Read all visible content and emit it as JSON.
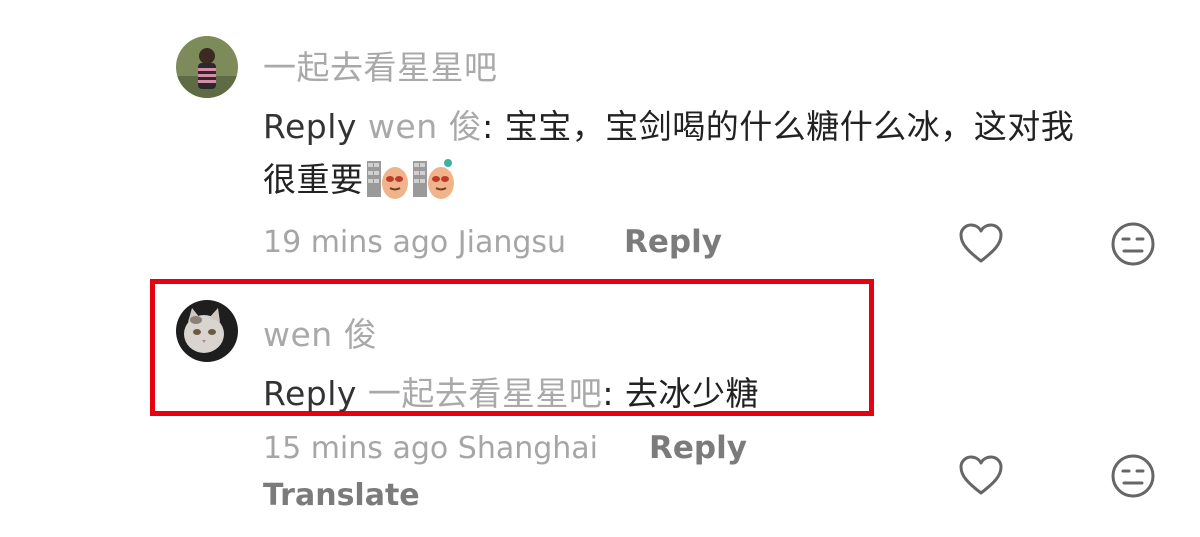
{
  "comments": [
    {
      "username": "一起去看星星吧",
      "reply_word": "Reply",
      "mention": "wen 俊",
      "text_line1": ": 宝宝，宝剑喝的什么糖什么冰，这对我",
      "text_line2": "很重要",
      "time": "19 mins ago",
      "location": "Jiangsu",
      "reply_label": "Reply"
    },
    {
      "username": "wen 俊",
      "reply_word": "Reply",
      "mention": "一起去看星星吧",
      "text": ": 去冰少糖",
      "time": "15 mins ago",
      "location": "Shanghai",
      "reply_label": "Reply",
      "translate_label": "Translate"
    }
  ],
  "icons": {
    "like": "heart-outline-icon",
    "dislike": "neutral-face-icon"
  },
  "colors": {
    "highlight": "#e60012",
    "muted_text": "#a9a9a9",
    "action_text": "#7b7b7b",
    "body_text": "#222222"
  }
}
